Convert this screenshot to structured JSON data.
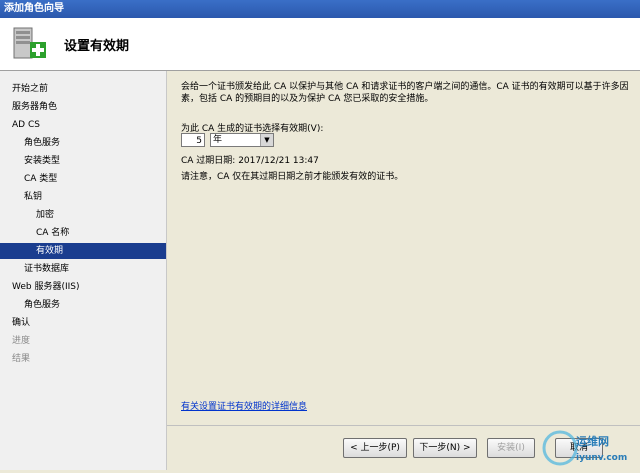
{
  "window": {
    "title": "添加角色向导"
  },
  "header": {
    "title": "设置有效期",
    "icon": "server-add-icon"
  },
  "nav": {
    "items": [
      {
        "label": "开始之前",
        "indent": 0,
        "state": "normal"
      },
      {
        "label": "服务器角色",
        "indent": 0,
        "state": "normal"
      },
      {
        "label": "AD CS",
        "indent": 0,
        "state": "normal"
      },
      {
        "label": "角色服务",
        "indent": 1,
        "state": "normal"
      },
      {
        "label": "安装类型",
        "indent": 1,
        "state": "normal"
      },
      {
        "label": "CA 类型",
        "indent": 1,
        "state": "normal"
      },
      {
        "label": "私钥",
        "indent": 1,
        "state": "normal"
      },
      {
        "label": "加密",
        "indent": 2,
        "state": "normal"
      },
      {
        "label": "CA 名称",
        "indent": 2,
        "state": "normal"
      },
      {
        "label": "有效期",
        "indent": 2,
        "state": "selected"
      },
      {
        "label": "证书数据库",
        "indent": 1,
        "state": "normal"
      },
      {
        "label": "Web 服务器(IIS)",
        "indent": 0,
        "state": "normal"
      },
      {
        "label": "角色服务",
        "indent": 1,
        "state": "normal"
      },
      {
        "label": "确认",
        "indent": 0,
        "state": "normal"
      },
      {
        "label": "进度",
        "indent": 0,
        "state": "dim"
      },
      {
        "label": "结果",
        "indent": 0,
        "state": "dim"
      }
    ]
  },
  "main": {
    "description": "会给一个证书颁发给此 CA 以保护与其他 CA 和请求证书的客户端之间的通信。CA 证书的有效期可以基于许多因素，包括 CA 的预期目的以及为保护 CA 您已采取的安全措施。",
    "validity_label": "为此 CA 生成的证书选择有效期(V):",
    "validity_value": "5",
    "validity_unit": "年",
    "expiry_text": "CA 过期日期:  2017/12/21 13:47",
    "note": "请注意，CA 仅在其过期日期之前才能颁发有效的证书。",
    "help_link": "有关设置证书有效期的详细信息"
  },
  "buttons": {
    "prev": "< 上一步(P)",
    "next": "下一步(N) >",
    "install": "安装(I)",
    "cancel": "取消"
  },
  "watermark": {
    "text1": "运维网",
    "text2": "iyunv.com"
  }
}
